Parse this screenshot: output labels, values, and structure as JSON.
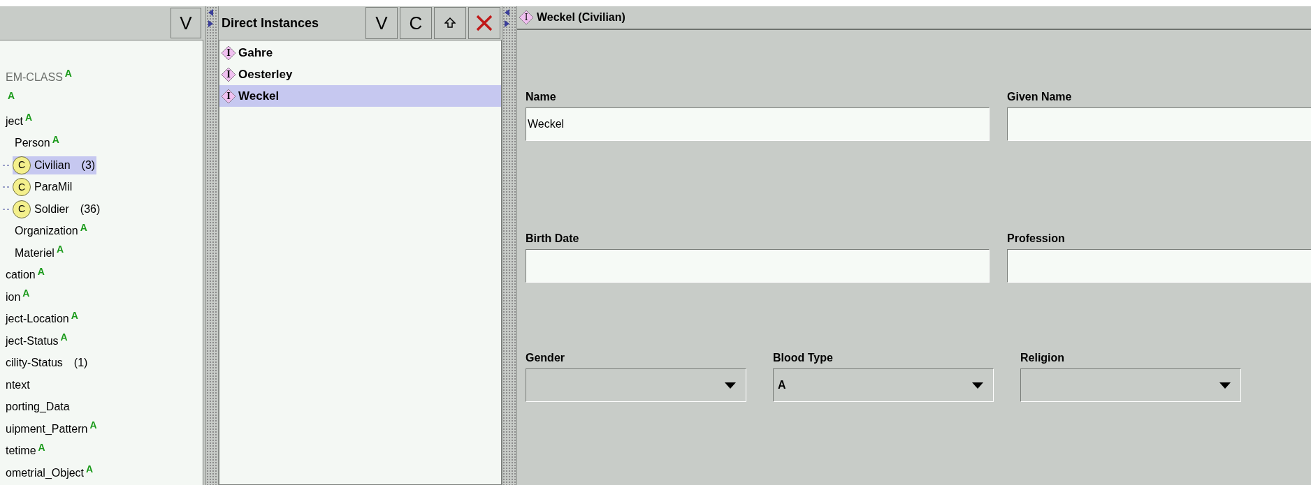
{
  "class_panel": {
    "header_buttons": [
      "V"
    ],
    "tree": [
      {
        "label": "EM-CLASS",
        "badge": "A",
        "greyed": true,
        "selected": false
      },
      {
        "badge": "A",
        "greyed": false,
        "selected": false
      },
      {
        "label": "ject",
        "badge": "A",
        "greyed": false,
        "selected": false,
        "children": [
          {
            "label": "Person",
            "badge": "A",
            "greyed": false,
            "selected": false,
            "children": [
              {
                "icon": "C",
                "label": "Civilian",
                "count": "(3)",
                "greyed": false,
                "selected": true
              },
              {
                "icon": "C",
                "label": "ParaMil",
                "greyed": false,
                "selected": false
              },
              {
                "icon": "C",
                "label": "Soldier",
                "count": "(36)",
                "greyed": false,
                "selected": false
              }
            ]
          },
          {
            "label": "Organization",
            "badge": "A",
            "greyed": false,
            "selected": false
          },
          {
            "label": "Materiel",
            "badge": "A",
            "greyed": false,
            "selected": false
          }
        ]
      },
      {
        "label": "cation",
        "badge": "A",
        "greyed": false,
        "selected": false
      },
      {
        "label": "ion",
        "badge": "A",
        "greyed": false,
        "selected": false
      },
      {
        "label": "ject-Location",
        "badge": "A",
        "greyed": false,
        "selected": false
      },
      {
        "label": "ject-Status",
        "badge": "A",
        "greyed": false,
        "selected": false
      },
      {
        "label": "cility-Status",
        "count": "(1)",
        "greyed": false,
        "selected": false
      },
      {
        "label": "ntext",
        "greyed": false,
        "selected": false
      },
      {
        "label": "porting_Data",
        "greyed": false,
        "selected": false
      },
      {
        "label": "uipment_Pattern",
        "badge": "A",
        "greyed": false,
        "selected": false
      },
      {
        "label": "tetime",
        "badge": "A",
        "greyed": false,
        "selected": false
      },
      {
        "label": "ometrial_Object",
        "badge": "A",
        "greyed": false,
        "selected": false
      }
    ]
  },
  "instances_panel": {
    "title": "Direct Instances",
    "buttons": [
      {
        "kind": "text",
        "label": "V"
      },
      {
        "kind": "text",
        "label": "C"
      },
      {
        "kind": "move-up"
      },
      {
        "kind": "delete"
      }
    ],
    "items": [
      {
        "icon": "I",
        "label": "Gahre",
        "selected": false
      },
      {
        "icon": "I",
        "label": "Oesterley",
        "selected": false
      },
      {
        "icon": "I",
        "label": "Weckel",
        "selected": true
      }
    ]
  },
  "form": {
    "icon": "I",
    "title": "Weckel (Civilian)",
    "rows": [
      [
        {
          "kind": "text",
          "label": "Name",
          "value": "Weckel"
        },
        {
          "kind": "text",
          "label": "Given Name"
        }
      ],
      [
        {
          "kind": "text",
          "label": "Birth Date"
        },
        {
          "kind": "text",
          "label": "Profession"
        }
      ],
      [
        {
          "kind": "choice",
          "label": "Gender"
        },
        {
          "kind": "choice",
          "label": "Blood Type",
          "value": "A"
        },
        {
          "kind": "choice",
          "label": "Religion"
        }
      ]
    ]
  }
}
